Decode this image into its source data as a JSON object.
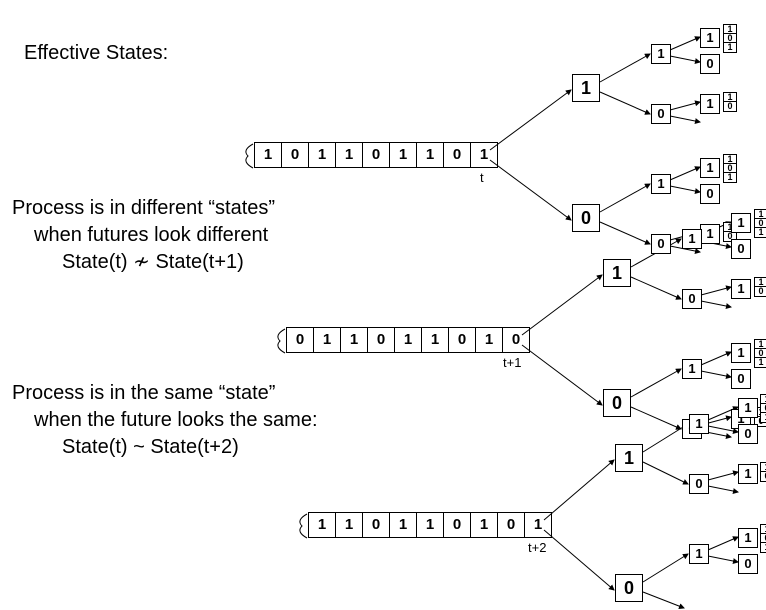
{
  "title": "Effective States:",
  "para1_line1": "Process is in different “states”",
  "para1_line2": "when futures look different",
  "para1_eq": "State(t) ≁ State(t+1)",
  "para2_line1": "Process is in the same “state”",
  "para2_line2": "when the future looks the same:",
  "para2_eq": "State(t) ~ State(t+2)",
  "tapes": {
    "t": {
      "cells": [
        "1",
        "0",
        "1",
        "1",
        "0",
        "1",
        "1",
        "0",
        "1"
      ],
      "label": "t"
    },
    "t1": {
      "cells": [
        "0",
        "1",
        "1",
        "0",
        "1",
        "1",
        "0",
        "1",
        "0"
      ],
      "label": "t+1"
    },
    "t2": {
      "cells": [
        "1",
        "1",
        "0",
        "1",
        "1",
        "0",
        "1",
        "0",
        "1"
      ],
      "label": "t+2"
    }
  },
  "tree": {
    "L": [
      "1",
      "0"
    ],
    "M": [
      "1",
      "0",
      "1",
      "0"
    ],
    "S3": [
      [
        "1",
        "0",
        "1"
      ],
      [
        "1",
        "0",
        "1"
      ]
    ],
    "S2": [
      [
        "1",
        "0"
      ],
      [
        "1",
        "0"
      ]
    ]
  }
}
